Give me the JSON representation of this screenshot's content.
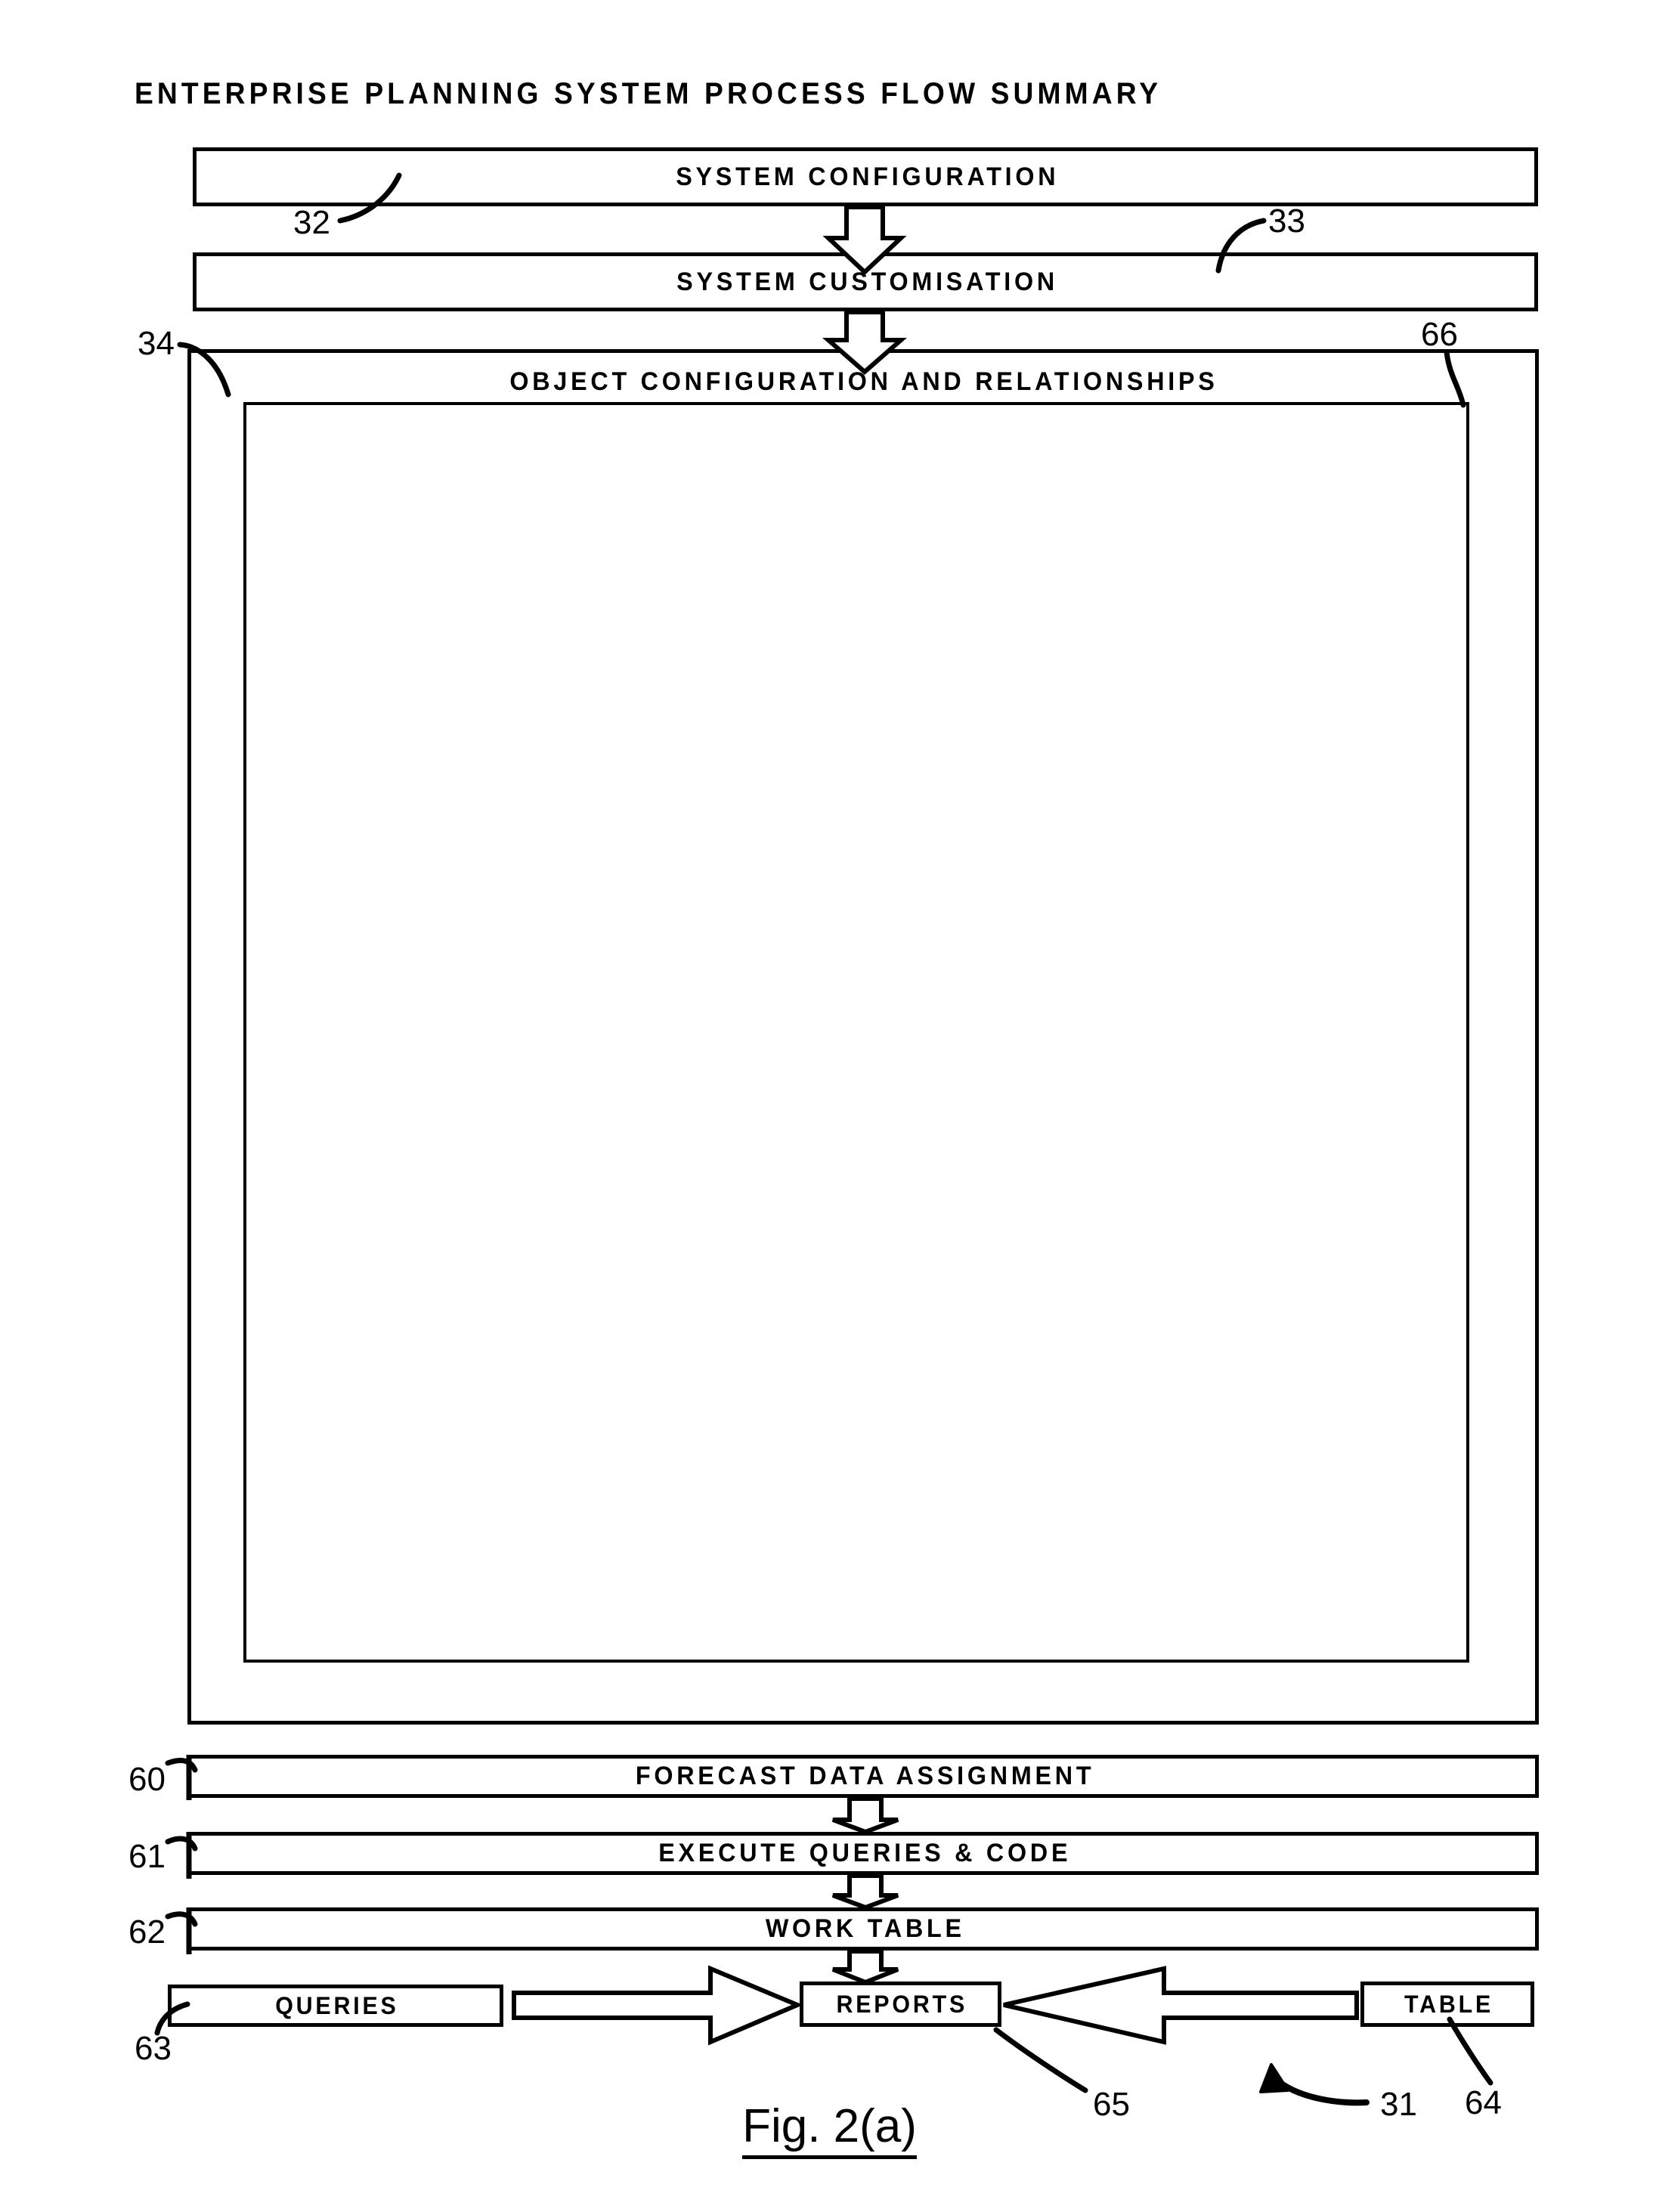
{
  "figure": {
    "title": "ENTERPRISE  PLANNING SYSTEM PROCESS FLOW SUMMARY",
    "caption": "Fig. 2(a)"
  },
  "boxes": {
    "system_configuration": {
      "label": "SYSTEM CONFIGURATION",
      "ref": "32"
    },
    "system_customisation": {
      "label": "SYSTEM CUSTOMISATION",
      "ref": "33"
    },
    "object_configuration": {
      "label": "OBJECT CONFIGURATION AND RELATIONSHIPS",
      "ref": "34"
    },
    "object_detail_panel": {
      "label": "",
      "ref": "66"
    },
    "forecast_data_assignment": {
      "label": "FORECAST DATA ASSIGNMENT",
      "ref": "60"
    },
    "execute_queries_code": {
      "label": "EXECUTE QUERIES & CODE",
      "ref": "61"
    },
    "work_table": {
      "label": "WORK TABLE",
      "ref": "62"
    },
    "queries": {
      "label": "QUERIES",
      "ref": "63"
    },
    "reports": {
      "label": "REPORTS",
      "ref": "65"
    },
    "table": {
      "label": "TABLE",
      "ref": "64"
    }
  },
  "refnums": {
    "r32": "32",
    "r33": "33",
    "r34": "34",
    "r66": "66",
    "r60": "60",
    "r61": "61",
    "r62": "62",
    "r63": "63",
    "r64": "64",
    "r65": "65",
    "r31": "31"
  },
  "colors": {
    "ink": "#000000",
    "paper": "#ffffff"
  }
}
